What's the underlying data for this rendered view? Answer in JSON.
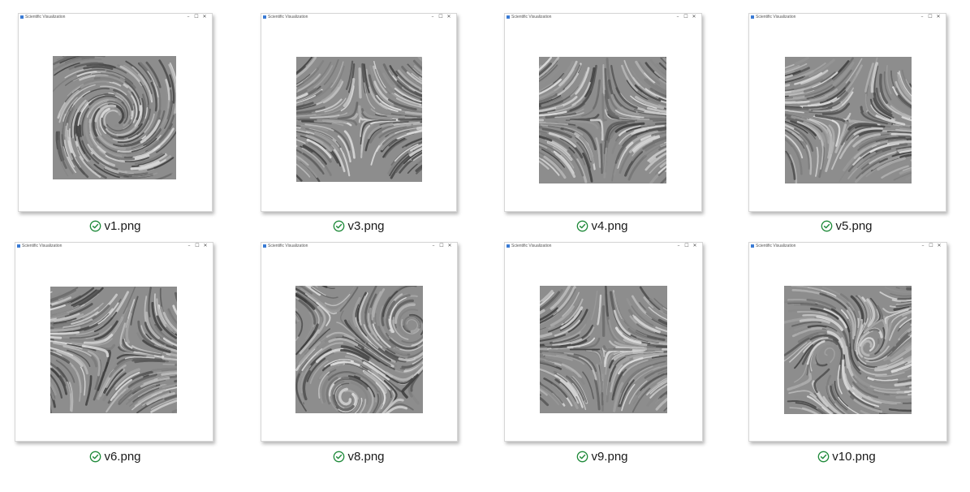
{
  "window_title": "Scientific Visualization",
  "window_controls": {
    "minimize": "–",
    "maximize": "☐",
    "close": "✕"
  },
  "status_color": "#1f8a3a",
  "files": [
    {
      "name": "v1.png",
      "pattern": "spiral",
      "status": "synced"
    },
    {
      "name": "v3.png",
      "pattern": "saddle",
      "status": "synced"
    },
    {
      "name": "v4.png",
      "pattern": "saddle",
      "status": "synced"
    },
    {
      "name": "v5.png",
      "pattern": "diagonal",
      "status": "synced"
    },
    {
      "name": "v6.png",
      "pattern": "diagonal",
      "status": "synced"
    },
    {
      "name": "v8.png",
      "pattern": "swirl",
      "status": "synced"
    },
    {
      "name": "v9.png",
      "pattern": "saddle",
      "status": "synced"
    },
    {
      "name": "v10.png",
      "pattern": "dipole",
      "status": "synced"
    }
  ]
}
